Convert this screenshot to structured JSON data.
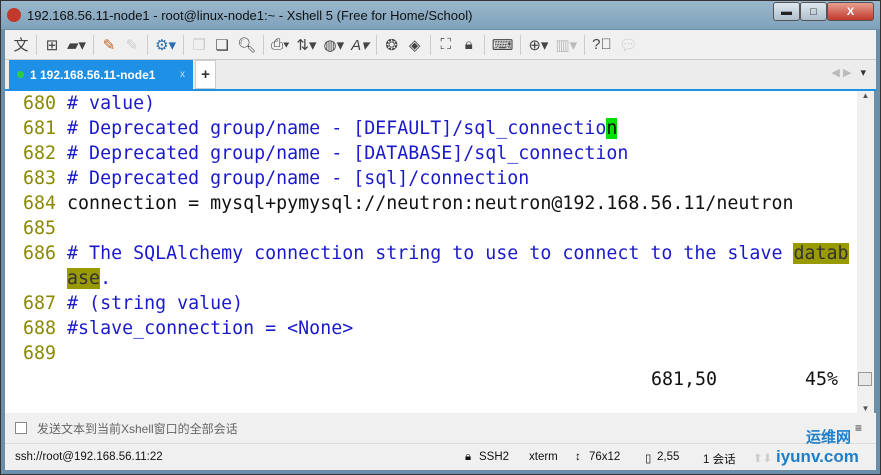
{
  "window": {
    "title": "192.168.56.11-node1 - root@linux-node1:~ - Xshell 5 (Free for Home/School)",
    "min": "▬",
    "max": "□",
    "close": "X"
  },
  "toolbar": {
    "icons": [
      "language",
      "new-session",
      "open",
      "connect",
      "disconnect",
      "properties",
      "copy",
      "paste",
      "find",
      "print",
      "transfer",
      "globe",
      "font",
      "xftp",
      "xmanager",
      "fullscreen",
      "lock",
      "keyboard",
      "add-pane",
      "layout",
      "help",
      "chat"
    ],
    "lang_label": "文"
  },
  "tabs": [
    {
      "label": "1 192.168.56.11-node1",
      "close": "x",
      "status_color": "#2ecc40"
    }
  ],
  "add_tab": "+",
  "terminal": {
    "lines": [
      {
        "n": "680",
        "parts": [
          {
            "t": "# value)",
            "c": "cm"
          }
        ]
      },
      {
        "n": "681",
        "parts": [
          {
            "t": "# Deprecated group/name - [DEFAULT]/sql_connectio",
            "c": "cm"
          },
          {
            "t": "n",
            "c": "cur"
          }
        ]
      },
      {
        "n": "682",
        "parts": [
          {
            "t": "# Deprecated group/name - [DATABASE]/sql_connection",
            "c": "cm"
          }
        ]
      },
      {
        "n": "683",
        "parts": [
          {
            "t": "# Deprecated group/name - [sql]/connection",
            "c": "cm"
          }
        ]
      },
      {
        "n": "684",
        "parts": [
          {
            "t": "connection = mysql+pymysql://neutron:neutron@192.168.56.11/neutron",
            "c": ""
          }
        ]
      },
      {
        "n": "685",
        "parts": []
      },
      {
        "n": "686",
        "parts": [
          {
            "t": "# The SQLAlchemy connection string to use to connect to the slave ",
            "c": "cm"
          },
          {
            "t": "datab",
            "c": "hl"
          }
        ]
      },
      {
        "n": "   ",
        "parts": [
          {
            "t": "ase",
            "c": "hl"
          },
          {
            "t": ".",
            "c": "cm"
          }
        ]
      },
      {
        "n": "687",
        "parts": [
          {
            "t": "# (string value)",
            "c": "cm"
          }
        ]
      },
      {
        "n": "688",
        "parts": [
          {
            "t": "#slave_connection = <None>",
            "c": "cm"
          }
        ]
      },
      {
        "n": "689",
        "parts": []
      }
    ],
    "cursor_pos": "681,50",
    "percent": "45%"
  },
  "sendbar": {
    "text": "发送文本到当前Xshell窗口的全部会话"
  },
  "status": {
    "address": "ssh://root@192.168.56.11:22",
    "protocol": "SSH2",
    "term": "xterm",
    "size": "76x12",
    "pos": "2,55",
    "sessions": "1 会话"
  },
  "watermark": {
    "text": "运维网 iyunv.com"
  }
}
